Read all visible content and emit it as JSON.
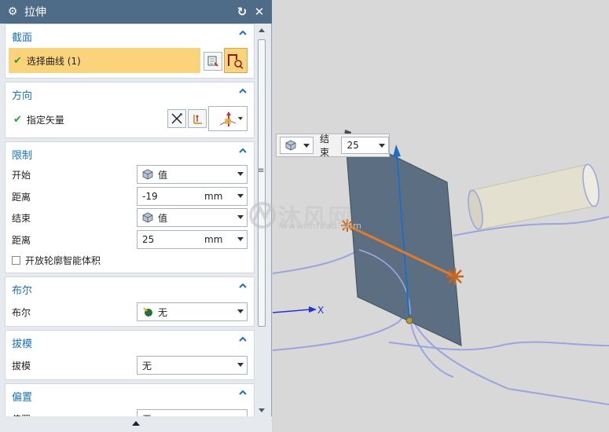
{
  "dialog": {
    "title": "拉伸",
    "sections": {
      "section": {
        "title": "截面",
        "select_curve_label": "选择曲线 (1)"
      },
      "direction": {
        "title": "方向",
        "specify_vector_label": "指定矢量"
      },
      "limits": {
        "title": "限制",
        "start_label": "开始",
        "start_option": "值",
        "start_distance_label": "距离",
        "start_distance_value": "-19",
        "start_distance_unit": "mm",
        "end_label": "结束",
        "end_option": "值",
        "end_distance_label": "距离",
        "end_distance_value": "25",
        "end_distance_unit": "mm",
        "open_profile_label": "开放轮廓智能体积"
      },
      "boolean": {
        "title": "布尔",
        "label": "布尔",
        "value": "无"
      },
      "draft": {
        "title": "拔模",
        "label": "拔模",
        "value": "无"
      },
      "offset": {
        "title": "偏置",
        "label": "偏置",
        "value": "无"
      }
    }
  },
  "viewport": {
    "floating_end_label": "结束",
    "floating_end_value": "25",
    "axis_x_label": "X",
    "watermark_text": "沐风网",
    "watermark_url": "www.mfcad.com"
  },
  "colors": {
    "title_bar": "#4e6b88",
    "section_title": "#1a73b6",
    "selected_row": "#fbd37a",
    "plane": "#5c6f82",
    "handle": "#e07a2c",
    "vector": "#1c6fbf",
    "curve": "#9aa4e0"
  }
}
